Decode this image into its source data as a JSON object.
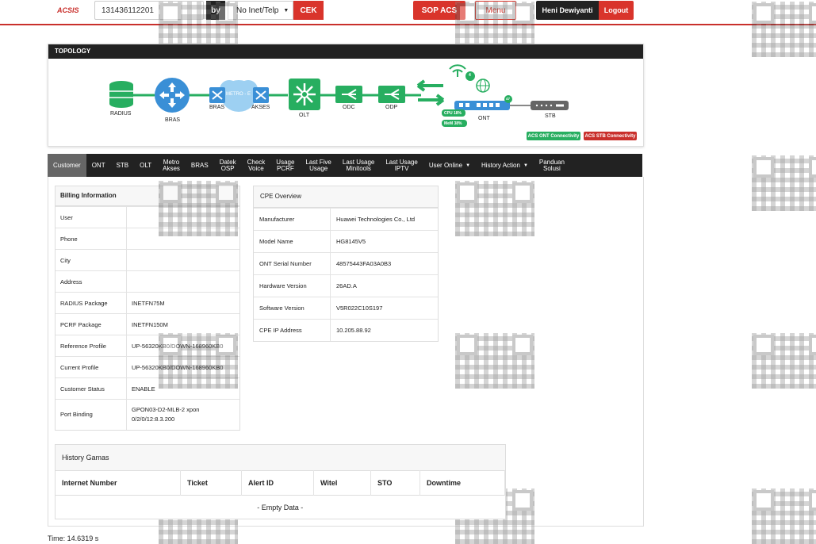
{
  "header": {
    "logo": "ACSIS",
    "search_value": "131436112201",
    "by_label": "by",
    "search_type": "No Inet/Telp",
    "cek_label": "CEK",
    "sop_label": "SOP ACS",
    "menu_label": "Menu",
    "user_name": "Heni Dewiyanti",
    "logout_label": "Logout"
  },
  "topology": {
    "title": "TOPOLOGY",
    "nodes": {
      "radius": "RADIUS",
      "bras1": "BRAS",
      "bras2": "BRAS",
      "metro": "METRO - E",
      "akses": "AKSES",
      "olt": "OLT",
      "odc": "ODC",
      "odp": "ODP",
      "ont": "ONT",
      "stb": "STB"
    },
    "ont_wifi_count": "4",
    "ont_port_badge": "47",
    "cpu": "CPU 18%",
    "mem": "MeM 38%",
    "acs_ont": "ACS ONT Connectivity",
    "acs_stb": "ACS STB Connectivity",
    "colors": {
      "green": "#27ae60",
      "blue": "#3a8fd6",
      "red": "#c9302c",
      "dark": "#222222"
    }
  },
  "tabs": [
    {
      "label": "Customer",
      "active": true
    },
    {
      "label": "ONT"
    },
    {
      "label": "STB"
    },
    {
      "label": "OLT"
    },
    {
      "label": "Metro\nAkses"
    },
    {
      "label": "BRAS"
    },
    {
      "label": "Datek\nOSP"
    },
    {
      "label": "Check\nVoice"
    },
    {
      "label": "Usage\nPCRF"
    },
    {
      "label": "Last Five\nUsage"
    },
    {
      "label": "Last Usage\nMinitools"
    },
    {
      "label": "Last Usage\nIPTV"
    },
    {
      "label": "User Online",
      "dropdown": true
    },
    {
      "label": "History Action",
      "dropdown": true
    },
    {
      "label": "Panduan\nSolusi"
    }
  ],
  "billing": {
    "title": "Billing Information",
    "rows": [
      {
        "key": "User",
        "value": ""
      },
      {
        "key": "Phone",
        "value": ""
      },
      {
        "key": "City",
        "value": ""
      },
      {
        "key": "Address",
        "value": ""
      },
      {
        "key": "RADIUS Package",
        "value": "INETFN75M"
      },
      {
        "key": "PCRF Package",
        "value": "INETFN150M"
      },
      {
        "key": "Reference Profile",
        "value": "UP-56320KB0/DOWN-168960KB0"
      },
      {
        "key": "Current Profile",
        "value": "UP-56320KB0/DOWN-168960KB0"
      },
      {
        "key": "Customer Status",
        "value": "ENABLE"
      },
      {
        "key": "Port Binding",
        "value": "GPON03-D2-MLB-2 xpon 0/2/0/12:8.3.200"
      }
    ]
  },
  "cpe": {
    "title": "CPE Overview",
    "rows": [
      {
        "key": "Manufacturer",
        "value": "Huawei Technologies Co., Ltd"
      },
      {
        "key": "Model Name",
        "value": "HG8145V5"
      },
      {
        "key": "ONT Serial Number",
        "value": "48575443FA03A0B3"
      },
      {
        "key": "Hardware Version",
        "value": "26AD.A"
      },
      {
        "key": "Software Version",
        "value": "V5R022C10S197"
      },
      {
        "key": "CPE IP Address",
        "value": "10.205.88.92"
      }
    ]
  },
  "history": {
    "title": "History Gamas",
    "columns": [
      "Internet Number",
      "Ticket",
      "Alert ID",
      "Witel",
      "STO",
      "Downtime"
    ],
    "empty_text": "- Empty Data -"
  },
  "footer": {
    "time": "Time: 14.6319 s"
  }
}
